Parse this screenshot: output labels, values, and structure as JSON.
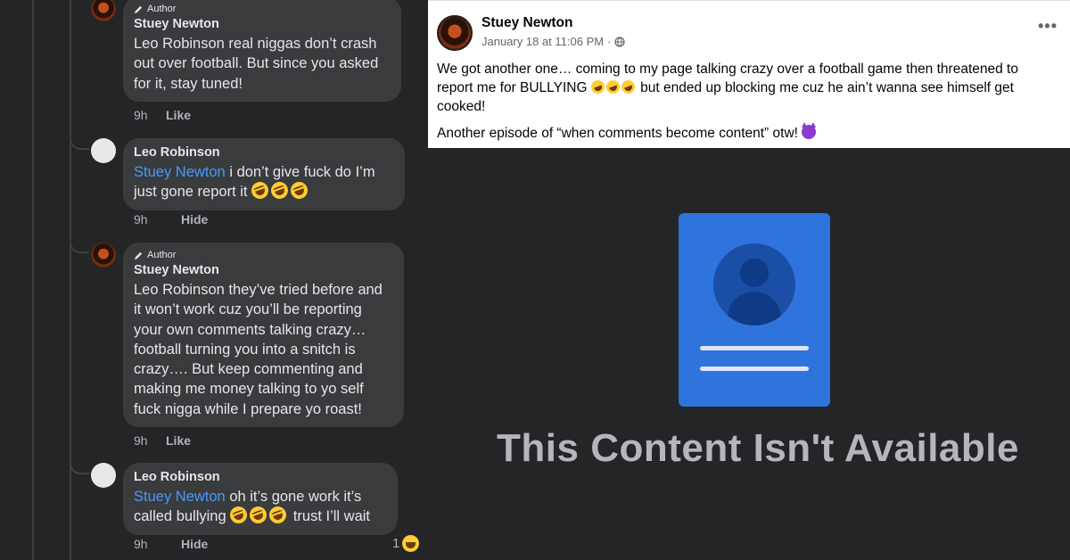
{
  "thread": {
    "comments": [
      {
        "author_badge": "Author",
        "name": "Stuey Newton",
        "mention": "",
        "text": "Leo Robinson real niggas don’t crash out over football. But since you asked for it, stay tuned!",
        "time": "9h",
        "action": "Like"
      },
      {
        "author_badge": "",
        "name": "Leo Robinson",
        "mention": "Stuey Newton",
        "text": " i don’t give fuck do  I’m just gone report it",
        "emoji_count": 3,
        "time": "9h",
        "action": "Hide"
      },
      {
        "author_badge": "Author",
        "name": "Stuey Newton",
        "mention": "",
        "text": "Leo Robinson they’ve tried before and it won’t work cuz you’ll be reporting your own comments talking crazy… football turning you into a snitch is crazy…. But keep commenting and making me money talking to yo self fuck nigga while I prepare yo roast!",
        "time": "9h",
        "action": "Like"
      },
      {
        "author_badge": "",
        "name": "Leo Robinson",
        "mention": "Stuey Newton",
        "text_before": " oh it’s gone work it’s called bullying",
        "text_after": " trust I’ll wait",
        "emoji_count": 3,
        "time": "9h",
        "action": "Hide",
        "reaction_count": "1"
      }
    ]
  },
  "post": {
    "name": "Stuey Newton",
    "date": "January 18 at 11:06 PM",
    "separator": "·",
    "more": "•••",
    "body_line1_before": "We got another one… coming to my page talking crazy over a football game then threatened to report me for BULLYING",
    "body_line1_after": " but ended up blocking me cuz he ain’t wanna see himself get cooked!",
    "body_line2": "Another episode of “when comments become content” otw!"
  },
  "unavailable": {
    "message": "This Content Isn't Available"
  },
  "colors": {
    "thread_bg": "#242526",
    "bubble_bg": "#3a3b3c",
    "mention": "#4599ff",
    "doc_icon": "#2f73dd"
  }
}
